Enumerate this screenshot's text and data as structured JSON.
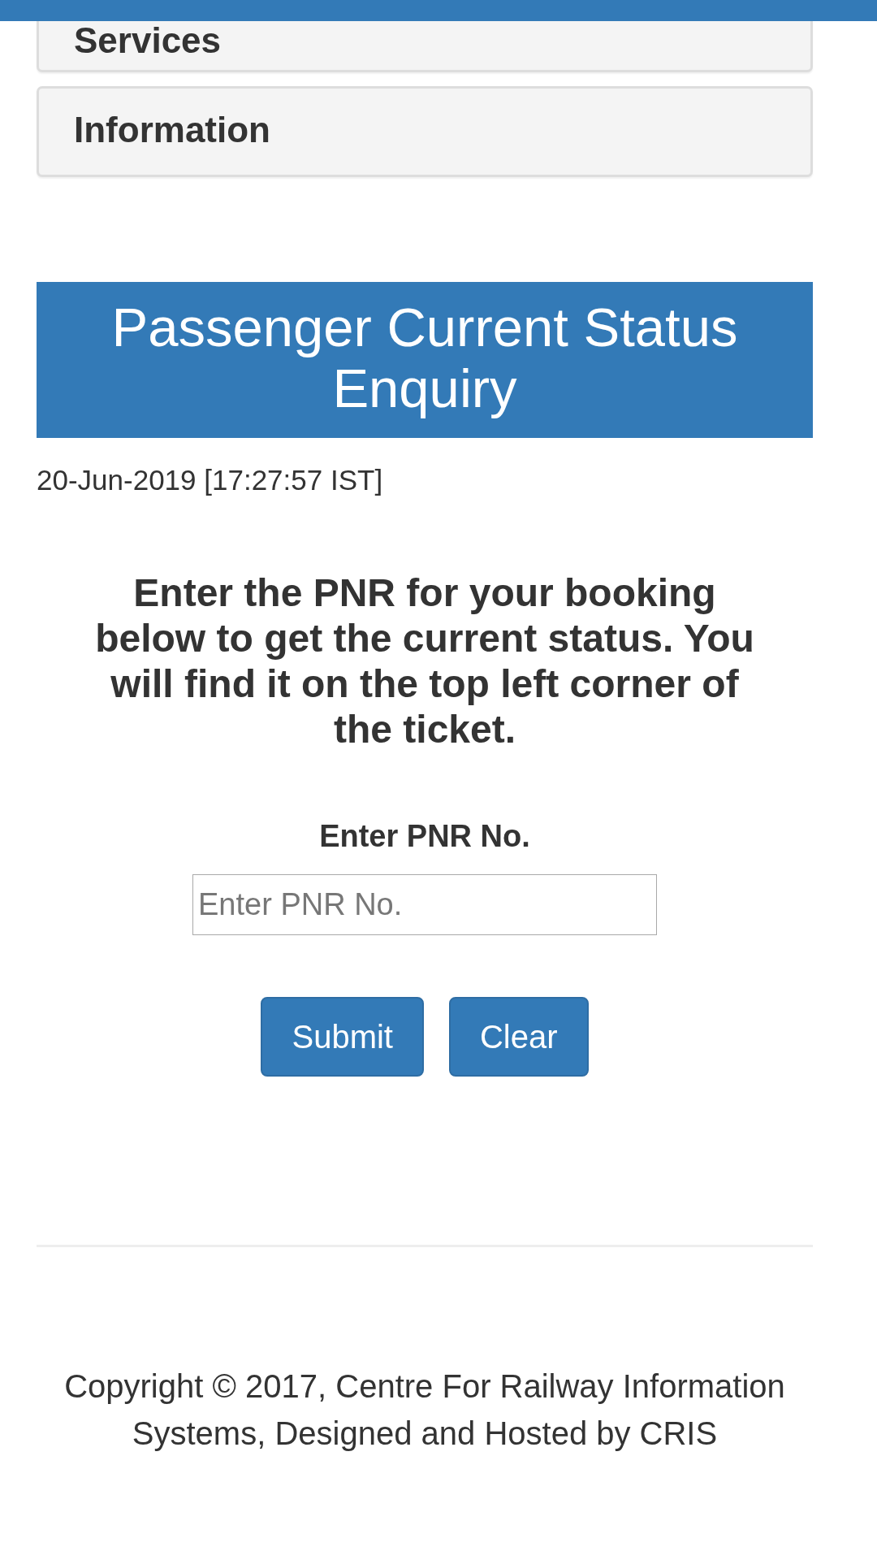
{
  "menu_panels": [
    {
      "label": "Services"
    },
    {
      "label": "Information"
    }
  ],
  "page_title": "Passenger Current Status Enquiry",
  "timestamp": "20-Jun-2019 [17:27:57 IST]",
  "instructions": "Enter the PNR for your booking below to get the current status. You will find it on the top left corner of the ticket.",
  "pnr_field": {
    "label": "Enter PNR No.",
    "placeholder": "Enter PNR No."
  },
  "buttons": [
    {
      "label": "Submit"
    },
    {
      "label": "Clear"
    }
  ],
  "footer": "Copyright © 2017, Centre For Railway Information Systems, Designed and Hosted by CRIS"
}
